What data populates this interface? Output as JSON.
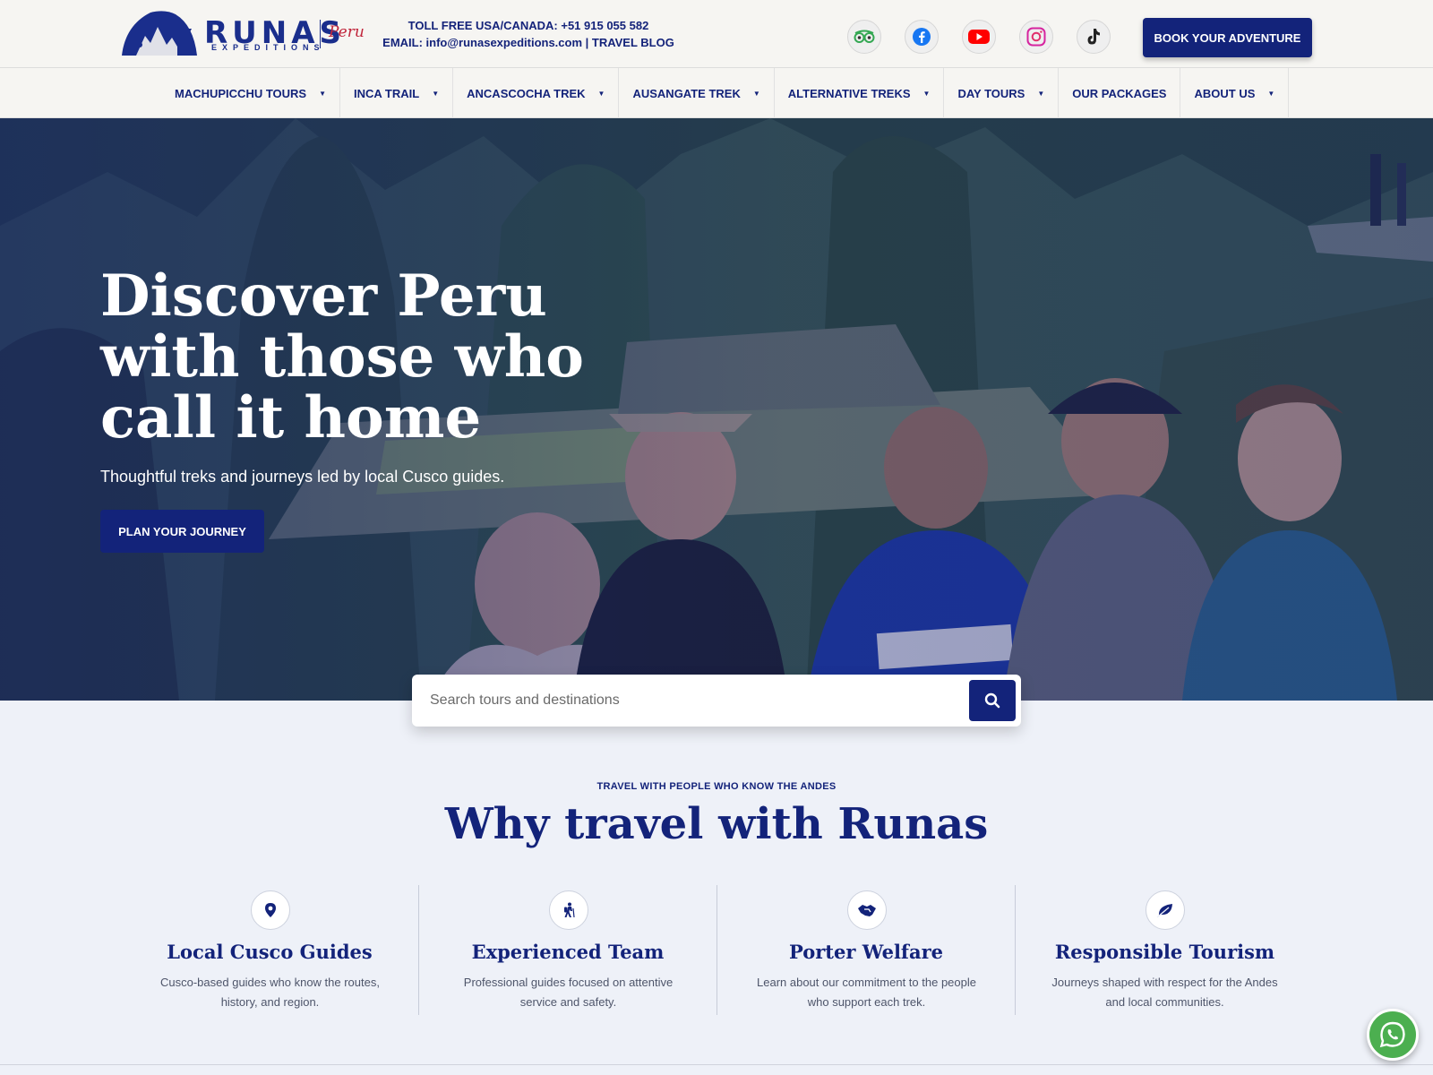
{
  "brand": {
    "name": "RUNAS",
    "sub": "EXPEDITIONS",
    "country": "Peru"
  },
  "contact": {
    "phone_line": "TOLL FREE USA/CANADA: +51 915 055 582",
    "email_line": "EMAIL: info@runasexpeditions.com | TRAVEL BLOG"
  },
  "social": [
    "tripadvisor-icon",
    "facebook-icon",
    "youtube-icon",
    "instagram-icon",
    "tiktok-icon"
  ],
  "book_button": "BOOK YOUR ADVENTURE",
  "nav": {
    "items": [
      {
        "label": "MACHUPICCHU TOURS",
        "dropdown": true
      },
      {
        "label": "INCA TRAIL",
        "dropdown": true
      },
      {
        "label": "ANCASCOCHA TREK",
        "dropdown": true
      },
      {
        "label": "AUSANGATE TREK",
        "dropdown": true
      },
      {
        "label": "ALTERNATIVE TREKS",
        "dropdown": true
      },
      {
        "label": "DAY TOURS",
        "dropdown": true
      },
      {
        "label": "OUR PACKAGES",
        "dropdown": false
      },
      {
        "label": "ABOUT US",
        "dropdown": true
      }
    ]
  },
  "hero": {
    "title_line1": "Discover Peru",
    "title_line2": "with those who",
    "title_line3": "call it home",
    "subtitle": "Thoughtful treks and journeys led by local Cusco guides.",
    "cta": "PLAN YOUR JOURNEY"
  },
  "search": {
    "placeholder": "Search tours and destinations"
  },
  "why": {
    "eyebrow": "TRAVEL WITH PEOPLE WHO KNOW THE ANDES",
    "title": "Why travel with Runas",
    "features": [
      {
        "icon": "map-pin-icon",
        "title": "Local Cusco Guides",
        "desc": "Cusco-based guides who know the routes, history, and region."
      },
      {
        "icon": "hiker-icon",
        "title": "Experienced Team",
        "desc": "Professional guides focused on attentive service and safety."
      },
      {
        "icon": "handshake-icon",
        "title": "Porter Welfare",
        "desc": "Learn about our commitment to the people who support each trek."
      },
      {
        "icon": "leaf-icon",
        "title": "Responsible Tourism",
        "desc": "Journeys shaped with respect for the Andes and local communities."
      }
    ]
  },
  "colors": {
    "brand_navy": "#13237a",
    "accent_red": "#c0243a",
    "whatsapp_green": "#4caf50",
    "page_bg": "#eef1f8"
  }
}
